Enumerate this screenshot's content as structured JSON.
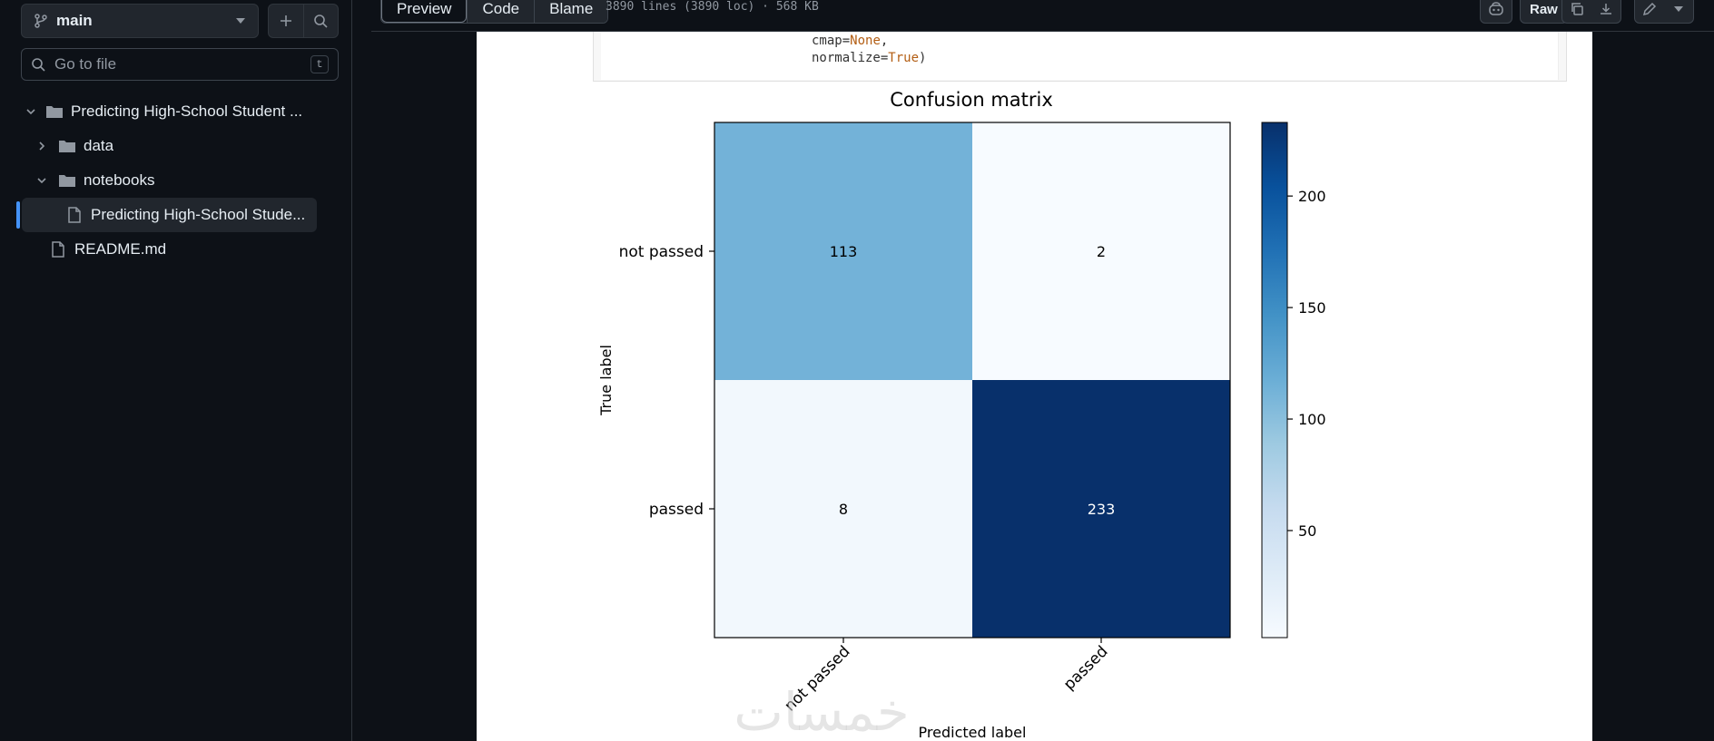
{
  "sidebar": {
    "branch": "main",
    "search_placeholder": "Go to file",
    "search_shortcut": "t",
    "tree": [
      {
        "label": "Predicting High-School Student ...",
        "type": "folder",
        "expanded": true,
        "depth": 0
      },
      {
        "label": "data",
        "type": "folder",
        "expanded": false,
        "depth": 1
      },
      {
        "label": "notebooks",
        "type": "folder",
        "expanded": true,
        "depth": 1
      },
      {
        "label": "Predicting High-School Stude...",
        "type": "file",
        "depth": 2,
        "selected": true
      },
      {
        "label": "README.md",
        "type": "file",
        "depth": 0
      }
    ]
  },
  "topbar": {
    "tabs": [
      "Preview",
      "Code",
      "Blame"
    ],
    "active_tab": "Preview",
    "file_meta": "3890 lines (3890 loc) · 568 KB",
    "raw_label": "Raw"
  },
  "code": {
    "line1_name": "cmap=",
    "line1_value": "None",
    "line1_end": ",",
    "line2_name": "normalize=",
    "line2_value": "True",
    "line2_end": ")"
  },
  "watermark": "خمسات",
  "chart_data": {
    "type": "heatmap",
    "title": "Confusion matrix",
    "xlabel": "Predicted label",
    "ylabel": "True label",
    "x_categories": [
      "not passed",
      "passed"
    ],
    "y_categories": [
      "not passed",
      "passed"
    ],
    "values": [
      [
        113,
        2
      ],
      [
        8,
        233
      ]
    ],
    "colormap": "Blues",
    "colorbar": {
      "min": 2,
      "max": 233,
      "ticks": [
        50,
        100,
        150,
        200
      ]
    },
    "grid": false
  }
}
